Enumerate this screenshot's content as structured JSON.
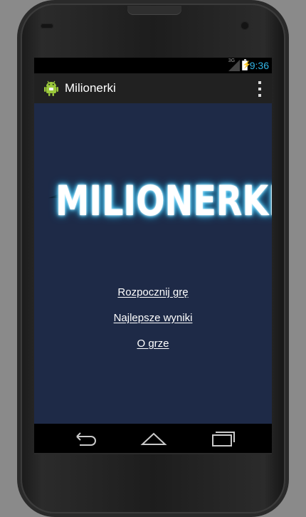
{
  "statusbar": {
    "network": "3G",
    "time": "9:36",
    "accent": "#33b5e5"
  },
  "actionbar": {
    "title": "Milionerki",
    "app_icon": "android-icon",
    "overflow_icon": "overflow-menu-icon"
  },
  "main": {
    "logo_text": "MILIONERKI",
    "background": "#1e2a47",
    "menu": [
      {
        "label": "Rozpocznij grę"
      },
      {
        "label": "Najlepsze wyniki"
      },
      {
        "label": "O grze"
      }
    ]
  },
  "navbar": {
    "back_icon": "back-icon",
    "home_icon": "home-icon",
    "recent_icon": "recent-apps-icon"
  }
}
